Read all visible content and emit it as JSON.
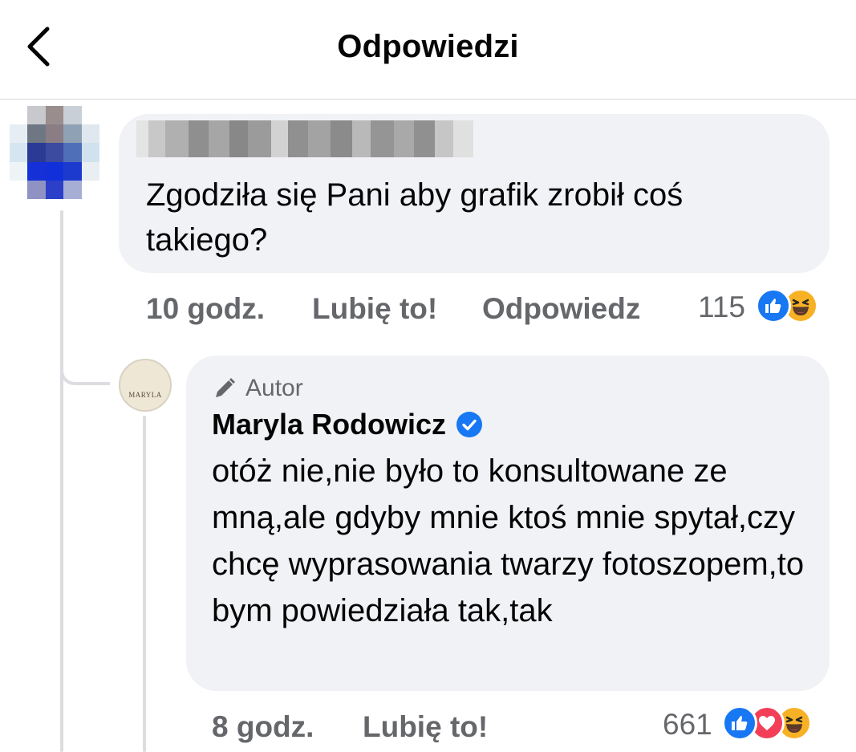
{
  "header": {
    "title": "Odpowiedzi",
    "back_icon": "chevron-left-icon"
  },
  "comment": {
    "text": "Zgodziła się Pani aby grafik zrobił coś takiego?",
    "time": "10 godz.",
    "like_label": "Lubię to!",
    "reply_label": "Odpowiedz",
    "reaction_count": "115",
    "reactions": [
      "like-icon",
      "haha-icon"
    ]
  },
  "reply": {
    "badge": "Autor",
    "author": "Maryla Rodowicz",
    "avatar_text": "MARYLA",
    "text": "otóż nie,nie było to konsultowane ze mną,ale gdyby mnie ktoś mnie spytał,czy chcę wyprasowania twarzy fotoszopem,to bym powiedziała tak,tak",
    "time": "8 godz.",
    "like_label": "Lubię to!",
    "reaction_count": "661",
    "reactions": [
      "like-icon",
      "love-icon",
      "haha-icon"
    ]
  },
  "colors": {
    "like_blue": "#1877f2",
    "love_red": "#f33e58",
    "haha_yellow": "#f7b125",
    "bubble_bg": "#f0f2f5",
    "secondary_text": "#65676b"
  }
}
